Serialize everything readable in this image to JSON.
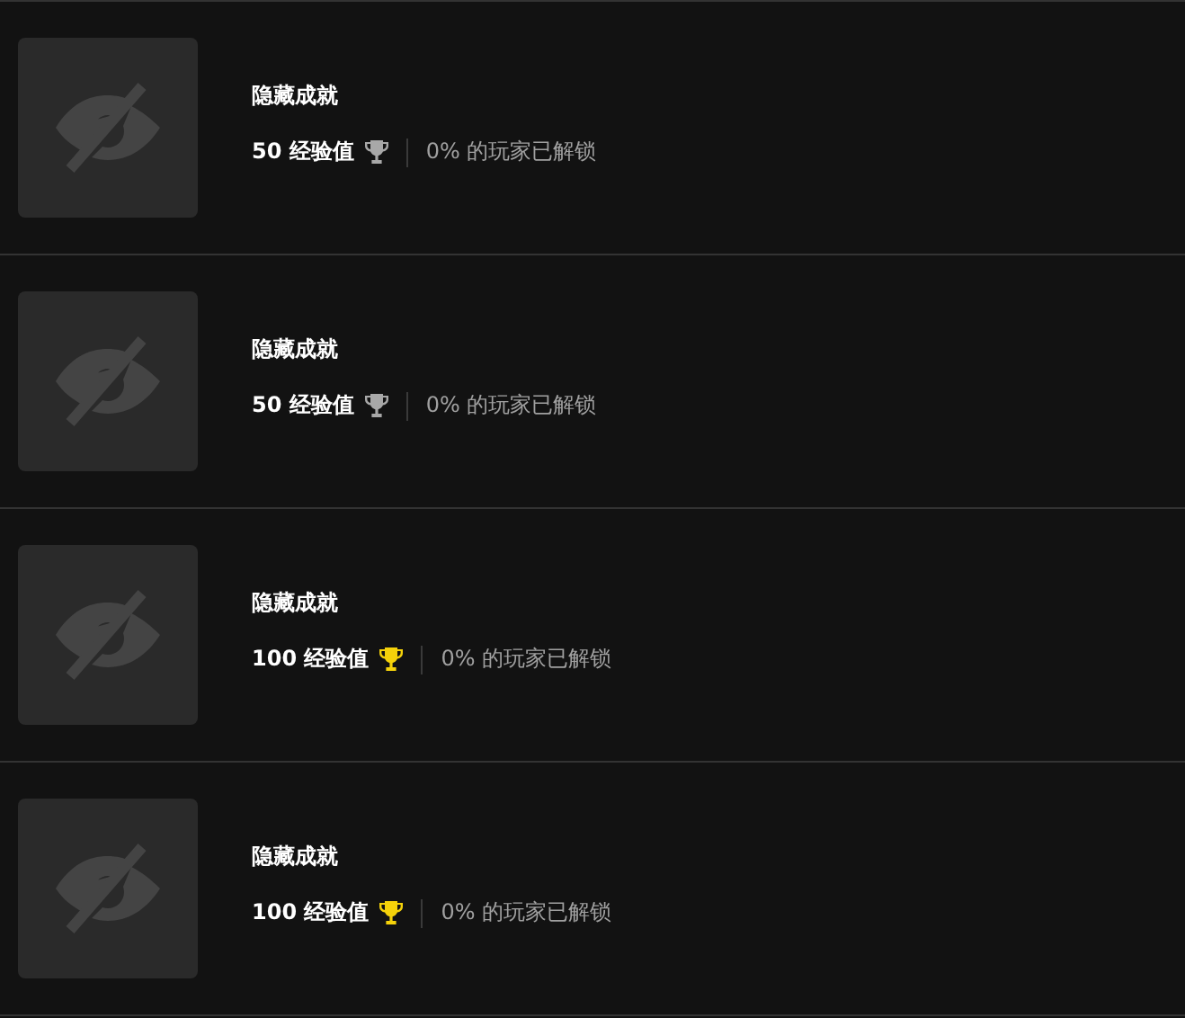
{
  "achievements": [
    {
      "title": "隐藏成就",
      "xp": "50 经验值",
      "color": "#a8a8a8",
      "unlocked": "0% 的玩家已解锁"
    },
    {
      "title": "隐藏成就",
      "xp": "50 经验值",
      "color": "#a8a8a8",
      "unlocked": "0% 的玩家已解锁"
    },
    {
      "title": "隐藏成就",
      "xp": "100 经验值",
      "color": "#f5d20a",
      "unlocked": "0% 的玩家已解锁"
    },
    {
      "title": "隐藏成就",
      "xp": "100 经验值",
      "color": "#f5d20a",
      "unlocked": "0% 的玩家已解锁"
    }
  ]
}
